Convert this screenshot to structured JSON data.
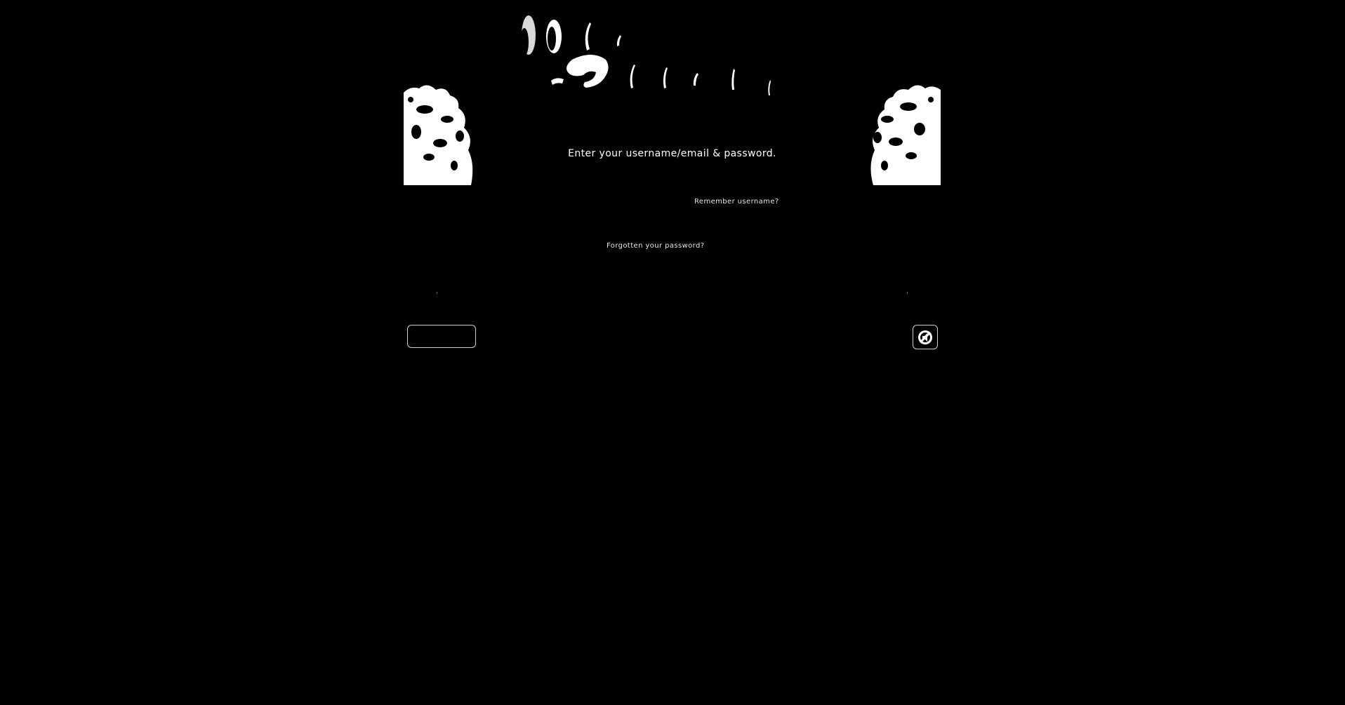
{
  "login": {
    "prompt": "Enter your username/email & password.",
    "remember_label": "Remember username?",
    "forgot_label": "Forgotten your password?"
  },
  "icons": {
    "banner": "runic-logo-art",
    "left_pillar": "rock-pillar-art",
    "right_pillar": "rock-pillar-art",
    "settings": "no-sound-icon"
  },
  "colors": {
    "background": "#000000",
    "text": "#ffffff",
    "button_border": "#cfcfcf"
  }
}
